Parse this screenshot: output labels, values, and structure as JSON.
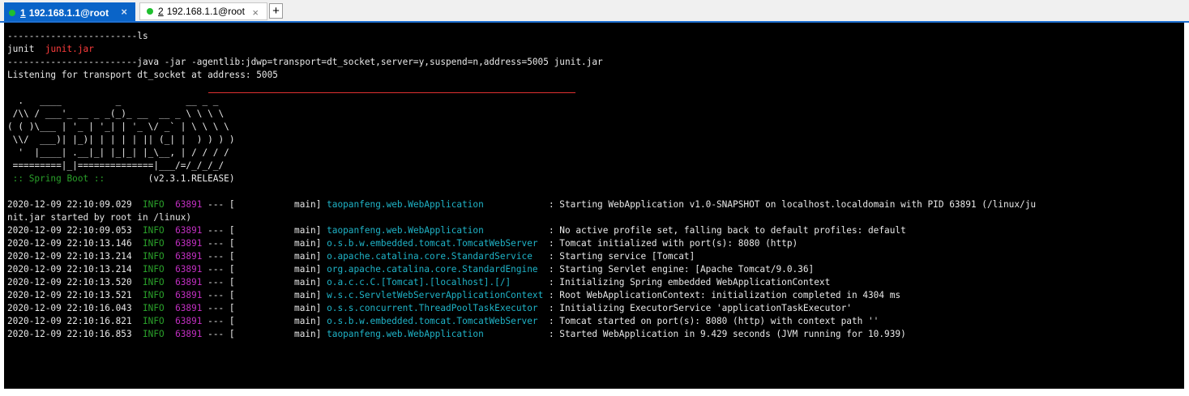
{
  "tabs": [
    {
      "num": "1",
      "title": "192.168.1.1@root",
      "close": "×"
    },
    {
      "num": "2",
      "title": "192.168.1.1@root",
      "close": "×"
    }
  ],
  "add_tab_label": "+",
  "terminal": {
    "ls_cmd": "------------------------ls",
    "ls_out_plain": "junit",
    "ls_out_jar": "junit.jar",
    "java_prefix": "------------------------java -jar ",
    "java_agent": "-agentlib:jdwp=transport=dt_socket,server=y,suspend=n,address=5005",
    "java_suffix": " junit.jar",
    "listening": "Listening for transport dt_socket at address: 5005",
    "banner": [
      "  .   ____          _            __ _ _",
      " /\\\\ / ___'_ __ _ _(_)_ __  __ _ \\ \\ \\ \\",
      "( ( )\\___ | '_ | '_| | '_ \\/ _` | \\ \\ \\ \\",
      " \\\\/  ___)| |_)| | | | | || (_| |  ) ) ) )",
      "  '  |____| .__|_| |_|_| |_\\__, | / / / /",
      " =========|_|==============|___/=/_/_/_/"
    ],
    "spring_boot_label": " :: Spring Boot :: ",
    "spring_boot_version": "       (v2.3.1.RELEASE)",
    "logs": [
      {
        "ts": "2020-12-09 22:10:09.029",
        "level": "INFO",
        "pid": "63891",
        "thread": " --- [           main] ",
        "logger": "taopanfeng.web.WebApplication           ",
        "msg": " : Starting WebApplication v1.0-SNAPSHOT on localhost.localdomain with PID 63891 (/linux/ju",
        "cont": "nit.jar started by root in /linux)"
      },
      {
        "ts": "2020-12-09 22:10:09.053",
        "level": "INFO",
        "pid": "63891",
        "thread": " --- [           main] ",
        "logger": "taopanfeng.web.WebApplication           ",
        "msg": " : No active profile set, falling back to default profiles: default"
      },
      {
        "ts": "2020-12-09 22:10:13.146",
        "level": "INFO",
        "pid": "63891",
        "thread": " --- [           main] ",
        "logger": "o.s.b.w.embedded.tomcat.TomcatWebServer ",
        "msg": " : Tomcat initialized with port(s): 8080 (http)"
      },
      {
        "ts": "2020-12-09 22:10:13.214",
        "level": "INFO",
        "pid": "63891",
        "thread": " --- [           main] ",
        "logger": "o.apache.catalina.core.StandardService  ",
        "msg": " : Starting service [Tomcat]"
      },
      {
        "ts": "2020-12-09 22:10:13.214",
        "level": "INFO",
        "pid": "63891",
        "thread": " --- [           main] ",
        "logger": "org.apache.catalina.core.StandardEngine ",
        "msg": " : Starting Servlet engine: [Apache Tomcat/9.0.36]"
      },
      {
        "ts": "2020-12-09 22:10:13.520",
        "level": "INFO",
        "pid": "63891",
        "thread": " --- [           main] ",
        "logger": "o.a.c.c.C.[Tomcat].[localhost].[/]      ",
        "msg": " : Initializing Spring embedded WebApplicationContext"
      },
      {
        "ts": "2020-12-09 22:10:13.521",
        "level": "INFO",
        "pid": "63891",
        "thread": " --- [           main] ",
        "logger": "w.s.c.ServletWebServerApplicationContext",
        "msg": " : Root WebApplicationContext: initialization completed in 4304 ms"
      },
      {
        "ts": "2020-12-09 22:10:16.043",
        "level": "INFO",
        "pid": "63891",
        "thread": " --- [           main] ",
        "logger": "o.s.s.concurrent.ThreadPoolTaskExecutor ",
        "msg": " : Initializing ExecutorService 'applicationTaskExecutor'"
      },
      {
        "ts": "2020-12-09 22:10:16.821",
        "level": "INFO",
        "pid": "63891",
        "thread": " --- [           main] ",
        "logger": "o.s.b.w.embedded.tomcat.TomcatWebServer ",
        "msg": " : Tomcat started on port(s): 8080 (http) with context path ''"
      },
      {
        "ts": "2020-12-09 22:10:16.853",
        "level": "INFO",
        "pid": "63891",
        "thread": " --- [           main] ",
        "logger": "taopanfeng.web.WebApplication           ",
        "msg": " : Started WebApplication in 9.429 seconds (JVM running for 10.939)"
      }
    ]
  }
}
